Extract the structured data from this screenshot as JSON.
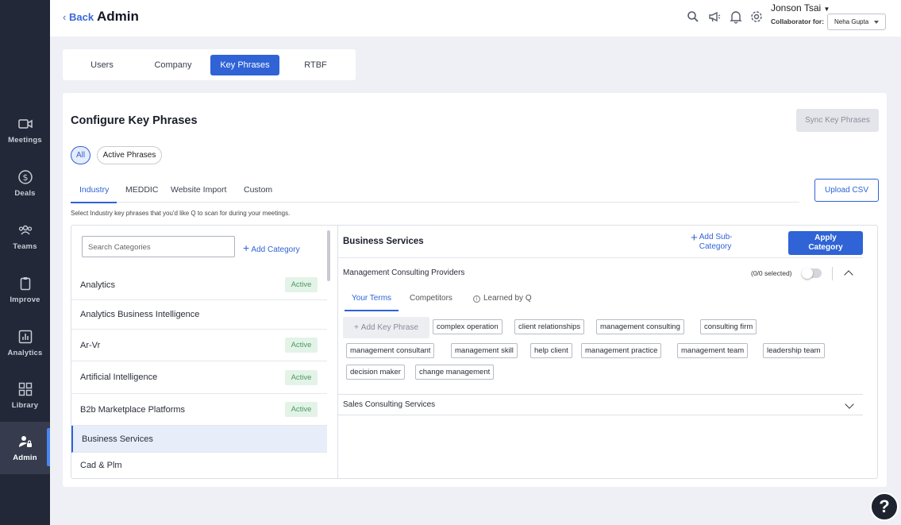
{
  "sidebar": {
    "items": [
      {
        "label": "Meetings",
        "icon": "video-icon"
      },
      {
        "label": "Deals",
        "icon": "dollar-icon"
      },
      {
        "label": "Teams",
        "icon": "team-icon"
      },
      {
        "label": "Improve",
        "icon": "clipboard-icon"
      },
      {
        "label": "Analytics",
        "icon": "chart-icon"
      },
      {
        "label": "Library",
        "icon": "grid-icon"
      },
      {
        "label": "Admin",
        "icon": "admin-user-icon"
      }
    ]
  },
  "header": {
    "back_label": "Back",
    "title": "Admin",
    "user_name": "Jonson Tsai",
    "collaborator_label": "Collaborator for:",
    "collaborator_value": "Neha Gupta"
  },
  "top_tabs": [
    "Users",
    "Company",
    "Key Phrases",
    "RTBF"
  ],
  "main": {
    "title": "Configure Key Phrases",
    "sync_button": "Sync Key Phrases",
    "filters": [
      "All",
      "Active Phrases"
    ],
    "sub_tabs": [
      "Industry",
      "MEDDIC",
      "Website Import",
      "Custom"
    ],
    "upload_button": "Upload CSV",
    "hint": "Select Industry key phrases that you'd like Q to scan for during your meetings."
  },
  "left_panel": {
    "search_placeholder": "Search Categories",
    "add_category": "Add Category",
    "categories": [
      {
        "name": "Analytics",
        "status": "Active"
      },
      {
        "name": "Analytics Business Intelligence",
        "status": ""
      },
      {
        "name": "Ar-Vr",
        "status": "Active"
      },
      {
        "name": "Artificial Intelligence",
        "status": "Active"
      },
      {
        "name": "B2b Marketplace Platforms",
        "status": "Active"
      },
      {
        "name": "Business Services",
        "status": ""
      },
      {
        "name": "Cad & Plm",
        "status": ""
      }
    ]
  },
  "right_panel": {
    "title": "Business Services",
    "add_sub_category_line1": "Add Sub-",
    "add_sub_category_line2": "Category",
    "apply_line1": "Apply",
    "apply_line2": "Category",
    "subcategory_1": "Management Consulting Providers",
    "selected_count": "(0/0 selected)",
    "inner_tabs": [
      "Your Terms",
      "Competitors",
      "Learned by Q"
    ],
    "add_key_phrase": "Add Key Phrase",
    "phrases": [
      "complex operation",
      "client relationships",
      "management consulting",
      "consulting firm",
      "management consultant",
      "management skill",
      "help client",
      "management practice",
      "management team",
      "leadership team",
      "decision maker",
      "change management"
    ],
    "subcategory_2": "Sales Consulting Services"
  },
  "help_label": "?"
}
